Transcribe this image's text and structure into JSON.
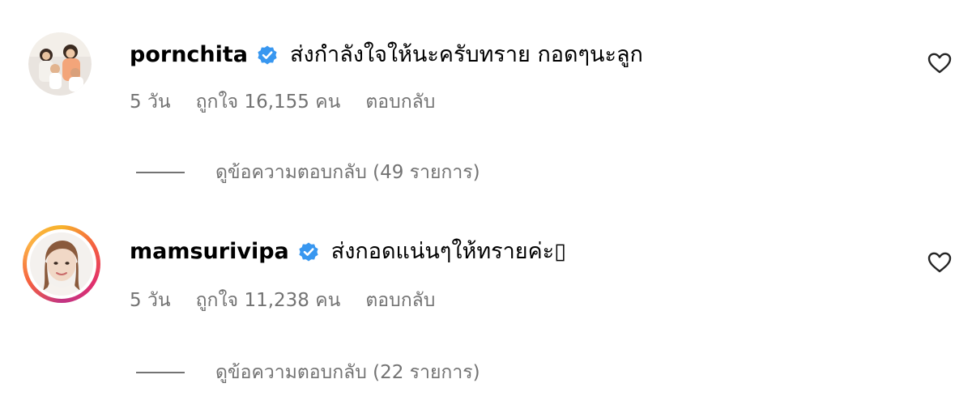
{
  "comments": [
    {
      "username": "pornchita",
      "text": "ส่งกำลังใจให้นะครับทราย กอดๆนะลูก",
      "time": "5 วัน",
      "likes": "ถูกใจ 16,155 คน",
      "reply_label": "ตอบกลับ",
      "view_replies": "ดูข้อความตอบกลับ (49 รายการ)",
      "verified": true,
      "avatar_icon": "family-photo-avatar",
      "like_icon": "heart-outline-icon"
    },
    {
      "username": "mamsurivipa",
      "text": "ส่งกอดแน่นๆให้ทรายค่ะ▯",
      "time": "5 วัน",
      "likes": "ถูกใจ 11,238 คน",
      "reply_label": "ตอบกลับ",
      "view_replies": "ดูข้อความตอบกลับ (22 รายการ)",
      "verified": true,
      "avatar_icon": "portrait-avatar-with-story-ring",
      "like_icon": "heart-outline-icon"
    }
  ],
  "colors": {
    "verified_badge": "#3897f0",
    "secondary_text": "#737373",
    "story_ring_start": "#f7b32b",
    "story_ring_end": "#c13584"
  }
}
